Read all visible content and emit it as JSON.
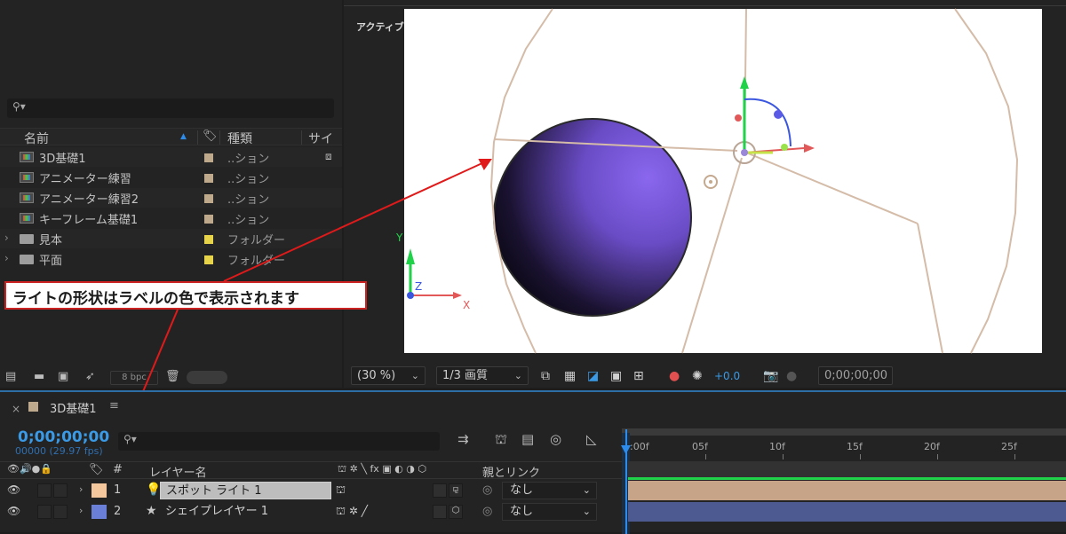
{
  "project": {
    "columns": {
      "name": "名前",
      "type": "種類",
      "size": "サイズ"
    },
    "items": [
      {
        "name": "3D基礎1",
        "type": "..ション",
        "label_color": "#bfa98c",
        "kind": "comp"
      },
      {
        "name": "アニメーター練習",
        "type": "..ション",
        "label_color": "#bfa98c",
        "kind": "comp"
      },
      {
        "name": "アニメーター練習2",
        "type": "..ション",
        "label_color": "#bfa98c",
        "kind": "comp"
      },
      {
        "name": "キーフレーム基礎1",
        "type": "..ション",
        "label_color": "#bfa98c",
        "kind": "comp"
      },
      {
        "name": "見本",
        "type": "フォルダー",
        "label_color": "#e8d44a",
        "kind": "folder"
      },
      {
        "name": "平面",
        "type": "フォルダー",
        "label_color": "#e8d44a",
        "kind": "folder"
      }
    ],
    "footer": {
      "bpc": "8 bpc"
    }
  },
  "viewer": {
    "camera_label": "アクティブカメラ ( デフォルト )",
    "zoom": "(30 %)",
    "resolution": "1/3 画質",
    "exposure": "+0.0",
    "timecode": "0;00;00;00",
    "axis_labels": {
      "x": "X",
      "y": "Y",
      "z": "Z"
    }
  },
  "callout": {
    "text": "ライトの形状はラベルの色で表示されます"
  },
  "timeline": {
    "tab_label": "3D基礎1",
    "timecode": "0;00;00;00",
    "fps": "00000 (29.97 fps)",
    "ruler": [
      "0:00f",
      "05f",
      "10f",
      "15f",
      "20f",
      "25f"
    ],
    "columns": {
      "layer_name": "レイヤー名",
      "parent_link": "親とリンク",
      "num": "#"
    },
    "layers": [
      {
        "num": "1",
        "name": "スポット ライト 1",
        "parent": "なし",
        "label_color": "#f4c89c",
        "bar_color": "#c7a488"
      },
      {
        "num": "2",
        "name": "シェイプレイヤー 1",
        "parent": "なし",
        "label_color": "#6a7fd8",
        "bar_color": "#4d5a91"
      }
    ]
  },
  "colors": {
    "accent": "#2d8ceb",
    "callout_border": "#cc2222",
    "sphere": "#7c5ce0"
  }
}
